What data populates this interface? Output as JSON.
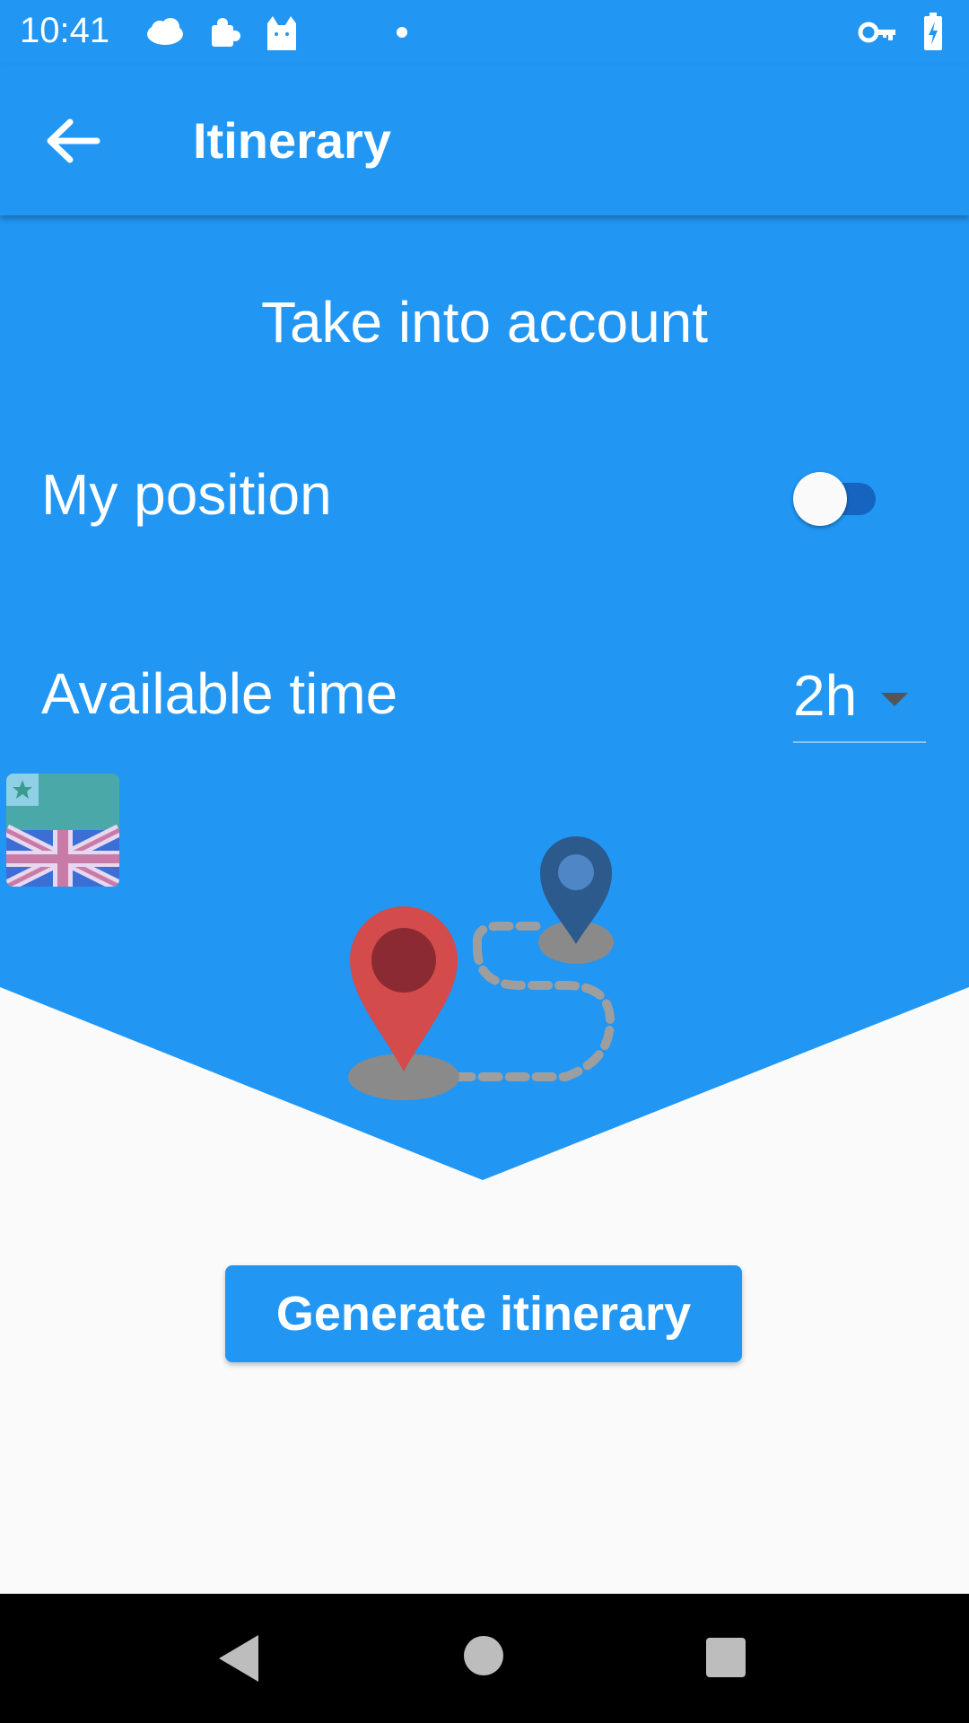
{
  "status_bar": {
    "time": "10:41",
    "left_icons": [
      "cloud-icon",
      "puzzle-icon",
      "cat-icon",
      "dot-icon"
    ],
    "right_icons": [
      "key-icon",
      "battery-charging-icon"
    ]
  },
  "app_bar": {
    "title": "Itinerary",
    "back_icon": "arrow-back-icon"
  },
  "settings": {
    "section_title": "Take into account",
    "my_position": {
      "label": "My position",
      "enabled": false
    },
    "available_time": {
      "label": "Available time",
      "value": "2h"
    }
  },
  "language": {
    "icon": "uk-flag-icon"
  },
  "illustration": {
    "icon": "route-map-pins-illustration"
  },
  "actions": {
    "generate_label": "Generate itinerary"
  },
  "nav_bar": {
    "icons": [
      "nav-back-icon",
      "nav-home-icon",
      "nav-recents-icon"
    ]
  },
  "colors": {
    "primary": "#2196F3",
    "background": "#FAFAFA",
    "toggle_track": "#1565C0",
    "pin_red": "#D34B4B",
    "pin_blue": "#2C5A8C"
  }
}
